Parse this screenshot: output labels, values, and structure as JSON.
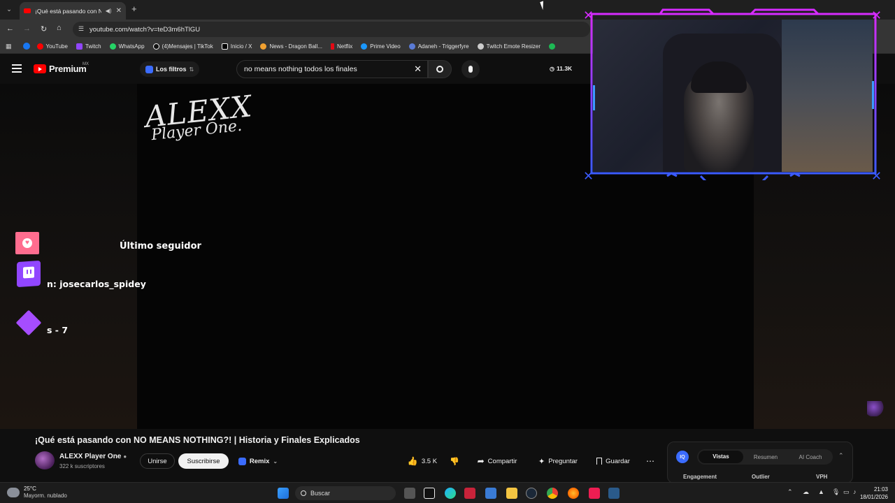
{
  "browser": {
    "active_tab_title": "¡Qué está pasando con N...",
    "url": "youtube.com/watch?v=teD3m6hTlGU",
    "bookmarks": [
      {
        "label": "YouTube",
        "color": "#ff0000"
      },
      {
        "label": "Twitch",
        "color": "#9146ff"
      },
      {
        "label": "WhatsApp",
        "color": "#25d366"
      },
      {
        "label": "(4)Mensajes | TikTok",
        "color": "#ffffff"
      },
      {
        "label": "Inicio / X",
        "color": "#ffffff"
      },
      {
        "label": "News - Dragon Ball...",
        "color": "#f0a030"
      },
      {
        "label": "Netflix",
        "color": "#e50914"
      },
      {
        "label": "Prime Video",
        "color": "#1a98ff"
      },
      {
        "label": "Adaneh - Triggerfyre",
        "color": "#5a7bd6"
      },
      {
        "label": "Twitch Emote Resizer",
        "color": "#cccccc"
      }
    ]
  },
  "youtube": {
    "logo_label": "Premium",
    "region": "MX",
    "filters_label": "Los filtros",
    "search_query": "no means nothing todos los finales",
    "view_counter": "11.3K"
  },
  "overlay": {
    "brand_line1": "ALEXX",
    "brand_line2": "Player One.",
    "follower_heading": "Último seguidor",
    "follower_name": "n: josecarlos_spidey",
    "subs_text": "s - 7"
  },
  "video": {
    "title": "¡Qué está pasando con NO MEANS NOTHING?! | Historia y Finales Explicados",
    "channel_name": "ALEXX Player One",
    "subscribers": "322 k suscriptores",
    "join_label": "Unirse",
    "subscribe_label": "Suscribirse",
    "remix_label": "Remix",
    "likes": "3.5 K",
    "share_label": "Compartir",
    "ask_label": "Preguntar",
    "save_label": "Guardar"
  },
  "iq_panel": {
    "tabs": [
      "Vistas",
      "Resumen",
      "AI Coach"
    ],
    "columns": [
      "Engagement",
      "Outlier",
      "VPH"
    ]
  },
  "taskbar": {
    "weather_temp": "25°C",
    "weather_desc": "Mayorm. nublado",
    "search_label": "Buscar",
    "time": "21:03",
    "date": "18/01/2026"
  },
  "colors": {
    "youtube_red": "#ff0000",
    "overlay_pink": "#ff4d8d",
    "overlay_purple": "#9146ff",
    "frame_blue": "#3b5bff",
    "frame_magenta": "#d62bff"
  }
}
